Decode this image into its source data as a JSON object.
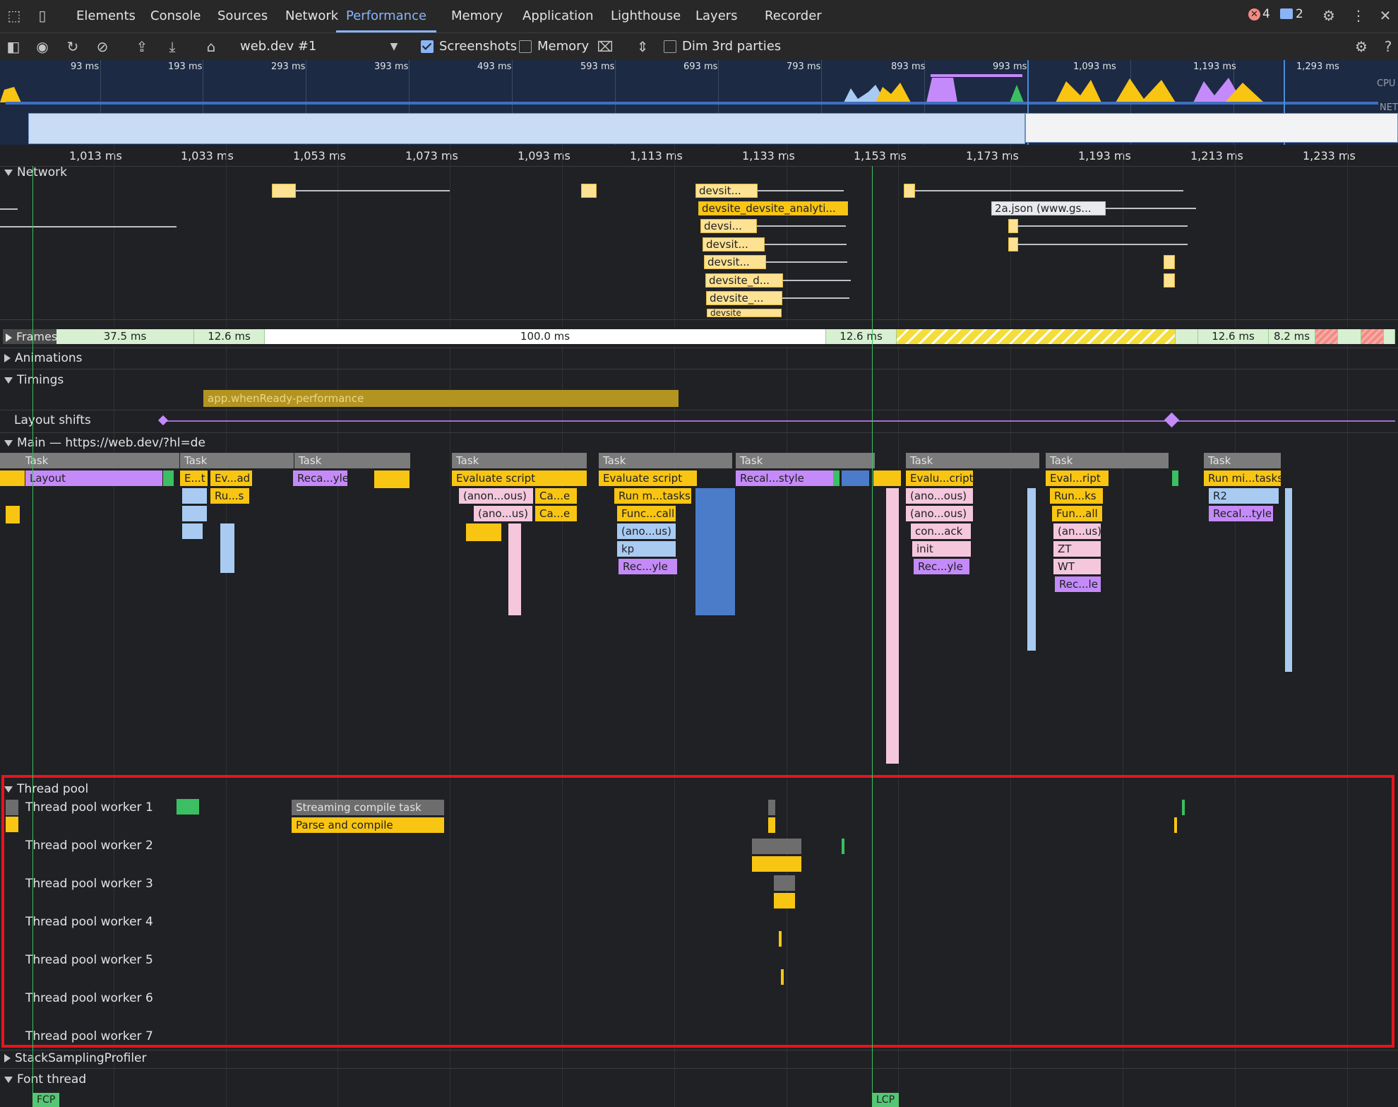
{
  "tabs": {
    "items": [
      "Elements",
      "Console",
      "Sources",
      "Network",
      "Performance",
      "Memory",
      "Application",
      "Lighthouse",
      "Layers",
      "Recorder"
    ],
    "active": "Performance",
    "errors": "4",
    "messages": "2"
  },
  "toolbar": {
    "recording": "web.dev #1",
    "screenshots_label": "Screenshots",
    "screenshots_checked": true,
    "memory_label": "Memory",
    "memory_checked": false,
    "dim_label": "Dim 3rd parties",
    "dim_checked": false
  },
  "overview": {
    "ticks": [
      "93 ms",
      "193 ms",
      "293 ms",
      "393 ms",
      "493 ms",
      "593 ms",
      "693 ms",
      "793 ms",
      "893 ms",
      "993 ms",
      "1,093 ms",
      "1,193 ms",
      "1,293 ms"
    ],
    "cpu_label": "CPU",
    "net_label": "NET"
  },
  "ruler": {
    "ticks": [
      "1,013 ms",
      "1,033 ms",
      "1,053 ms",
      "1,073 ms",
      "1,093 ms",
      "1,113 ms",
      "1,133 ms",
      "1,153 ms",
      "1,173 ms",
      "1,193 ms",
      "1,213 ms",
      "1,233 ms"
    ]
  },
  "network": {
    "title": "Network",
    "requests": [
      "devsit...",
      "devsite_devsite_analyti...",
      "devsi...",
      "devsit...",
      "devsit...",
      "devsite_d...",
      "devsite_...",
      "devsite",
      "2a.json (www.gs..."
    ]
  },
  "frames": {
    "title": "Frames",
    "durations": [
      "37.5 ms",
      "12.6 ms",
      "100.0 ms",
      "12.6 ms",
      "12.6 ms",
      "8.2 ms"
    ]
  },
  "tracks": {
    "animations": "Animations",
    "timings": "Timings",
    "timing_mark": "app.whenReady-performance",
    "layout_shifts": "Layout shifts",
    "main": "Main — https://web.dev/?hl=de",
    "thread_pool": "Thread pool",
    "stack_sampling": "StackSamplingProfiler",
    "font_thread": "Font thread"
  },
  "main_flame": {
    "task": "Task",
    "entries": [
      "Layout",
      "E...t",
      "Ev...ad",
      "Ru...s",
      "Reca...yle",
      "Evaluate script",
      "(anon...ous)",
      "(ano...us)",
      "Ca...e",
      "Ca...e",
      "Evaluate script",
      "Run m...tasks",
      "Func...call",
      "(ano...us)",
      "kp",
      "Rec...yle",
      "Recal...style",
      "Evalu...cript",
      "(ano...ous)",
      "(ano...ous)",
      "con...ack",
      "init",
      "Rec...yle",
      "Eval...ript",
      "Run...ks",
      "Fun...all",
      "(an...us)",
      "ZT",
      "WT",
      "Rec...le",
      "Run mi...tasks",
      "R2",
      "Recal...tyle"
    ]
  },
  "thread_pool": {
    "workers": [
      "Thread pool worker 1",
      "Thread pool worker 2",
      "Thread pool worker 3",
      "Thread pool worker 4",
      "Thread pool worker 5",
      "Thread pool worker 6",
      "Thread pool worker 7"
    ],
    "streaming_label": "Streaming compile task",
    "parse_label": "Parse and compile"
  },
  "markers": {
    "fcp": "FCP",
    "lcp": "LCP"
  },
  "colors": {
    "accent": "#8ab4f8",
    "scripting": "#f9c513",
    "rendering": "#c58af9",
    "highlight": "#e8141c"
  }
}
